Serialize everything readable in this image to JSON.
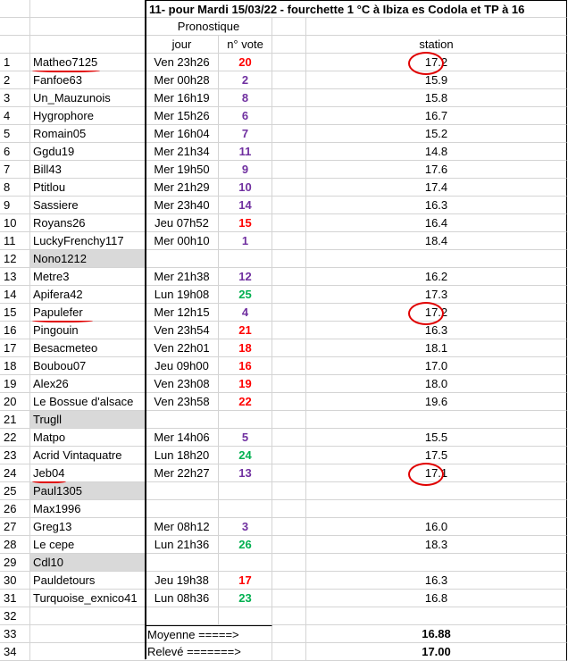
{
  "title": "11- pour Mardi 15/03/22 - fourchette 1 °C à Ibiza es Codola et TP à 16",
  "headers": {
    "pronostique": "Pronostique",
    "jour": "jour",
    "vote": "n° vote",
    "station": "station"
  },
  "rows": [
    {
      "n": "1",
      "name": "Matheo7125",
      "jour": "Ven 23h26",
      "vote": "20",
      "vc": "red",
      "station": "17.2",
      "hl": true
    },
    {
      "n": "2",
      "name": "Fanfoe63",
      "jour": "Mer 00h28",
      "vote": "2",
      "vc": "purple",
      "station": "15.9"
    },
    {
      "n": "3",
      "name": "Un_Mauzunois",
      "jour": "Mer 16h19",
      "vote": "8",
      "vc": "purple",
      "station": "15.8"
    },
    {
      "n": "4",
      "name": "Hygrophore",
      "jour": "Mer 15h26",
      "vote": "6",
      "vc": "purple",
      "station": "16.7"
    },
    {
      "n": "5",
      "name": "Romain05",
      "jour": "Mer 16h04",
      "vote": "7",
      "vc": "purple",
      "station": "15.2"
    },
    {
      "n": "6",
      "name": "Ggdu19",
      "jour": "Mer 21h34",
      "vote": "11",
      "vc": "purple",
      "station": "14.8"
    },
    {
      "n": "7",
      "name": "Bill43",
      "jour": "Mer 19h50",
      "vote": "9",
      "vc": "purple",
      "station": "17.6"
    },
    {
      "n": "8",
      "name": "Ptitlou",
      "jour": "Mer 21h29",
      "vote": "10",
      "vc": "purple",
      "station": "17.4"
    },
    {
      "n": "9",
      "name": "Sassiere",
      "jour": "Mer 23h40",
      "vote": "14",
      "vc": "purple",
      "station": "16.3"
    },
    {
      "n": "10",
      "name": "Royans26",
      "jour": "Jeu 07h52",
      "vote": "15",
      "vc": "red",
      "station": "16.4"
    },
    {
      "n": "11",
      "name": "LuckyFrenchy117",
      "jour": "Mer 00h10",
      "vote": "1",
      "vc": "purple",
      "station": "18.4"
    },
    {
      "n": "12",
      "name": "Nono1212",
      "jour": "",
      "vote": "",
      "vc": "",
      "station": "",
      "gray": true
    },
    {
      "n": "13",
      "name": "Metre3",
      "jour": "Mer 21h38",
      "vote": "12",
      "vc": "purple",
      "station": "16.2"
    },
    {
      "n": "14",
      "name": "Apifera42",
      "jour": "Lun 19h08",
      "vote": "25",
      "vc": "green",
      "station": "17.3"
    },
    {
      "n": "15",
      "name": "Papulefer",
      "jour": "Mer 12h15",
      "vote": "4",
      "vc": "purple",
      "station": "17.2",
      "hl": true
    },
    {
      "n": "16",
      "name": "Pingouin",
      "jour": "Ven 23h54",
      "vote": "21",
      "vc": "red",
      "station": "16.3"
    },
    {
      "n": "17",
      "name": "Besacmeteo",
      "jour": "Ven 22h01",
      "vote": "18",
      "vc": "red",
      "station": "18.1"
    },
    {
      "n": "18",
      "name": "Boubou07",
      "jour": "Jeu 09h00",
      "vote": "16",
      "vc": "red",
      "station": "17.0"
    },
    {
      "n": "19",
      "name": "Alex26",
      "jour": "Ven 23h08",
      "vote": "19",
      "vc": "red",
      "station": "18.0"
    },
    {
      "n": "20",
      "name": "Le Bossue d'alsace",
      "jour": "Ven 23h58",
      "vote": "22",
      "vc": "red",
      "station": "19.6"
    },
    {
      "n": "21",
      "name": "Trugll",
      "jour": "",
      "vote": "",
      "vc": "",
      "station": "",
      "gray": true
    },
    {
      "n": "22",
      "name": "Matpo",
      "jour": "Mer 14h06",
      "vote": "5",
      "vc": "purple",
      "station": "15.5"
    },
    {
      "n": "23",
      "name": "Acrid Vintaquatre",
      "jour": "Lun 18h20",
      "vote": "24",
      "vc": "green",
      "station": "17.5"
    },
    {
      "n": "24",
      "name": "Jeb04",
      "jour": "Mer 22h27",
      "vote": "13",
      "vc": "purple",
      "station": "17.1",
      "hl": true
    },
    {
      "n": "25",
      "name": "Paul1305",
      "jour": "",
      "vote": "",
      "vc": "",
      "station": "",
      "gray": true
    },
    {
      "n": "26",
      "name": "Max1996",
      "jour": "",
      "vote": "",
      "vc": "",
      "station": ""
    },
    {
      "n": "27",
      "name": "Greg13",
      "jour": "Mer 08h12",
      "vote": "3",
      "vc": "purple",
      "station": "16.0"
    },
    {
      "n": "28",
      "name": "Le cepe",
      "jour": "Lun 21h36",
      "vote": "26",
      "vc": "green",
      "station": "18.3"
    },
    {
      "n": "29",
      "name": "Cdl10",
      "jour": "",
      "vote": "",
      "vc": "",
      "station": "",
      "gray": true
    },
    {
      "n": "30",
      "name": "Pauldetours",
      "jour": "Jeu 19h38",
      "vote": "17",
      "vc": "red",
      "station": "16.3"
    },
    {
      "n": "31",
      "name": "Turquoise_exnico41",
      "jour": "Lun 08h36",
      "vote": "23",
      "vc": "green",
      "station": "16.8"
    },
    {
      "n": "32",
      "name": "",
      "jour": "",
      "vote": "",
      "vc": "",
      "station": ""
    }
  ],
  "footer": [
    {
      "n": "33",
      "label": "Moyenne =====>",
      "value": "16.88"
    },
    {
      "n": "34",
      "label": "Relevé =======>",
      "value": "17.00"
    }
  ],
  "colors": {
    "purple": "#7030a0",
    "red": "#ff0000",
    "green": "#00b050",
    "gray": "#d9d9d9",
    "annotation": "#e00000"
  }
}
